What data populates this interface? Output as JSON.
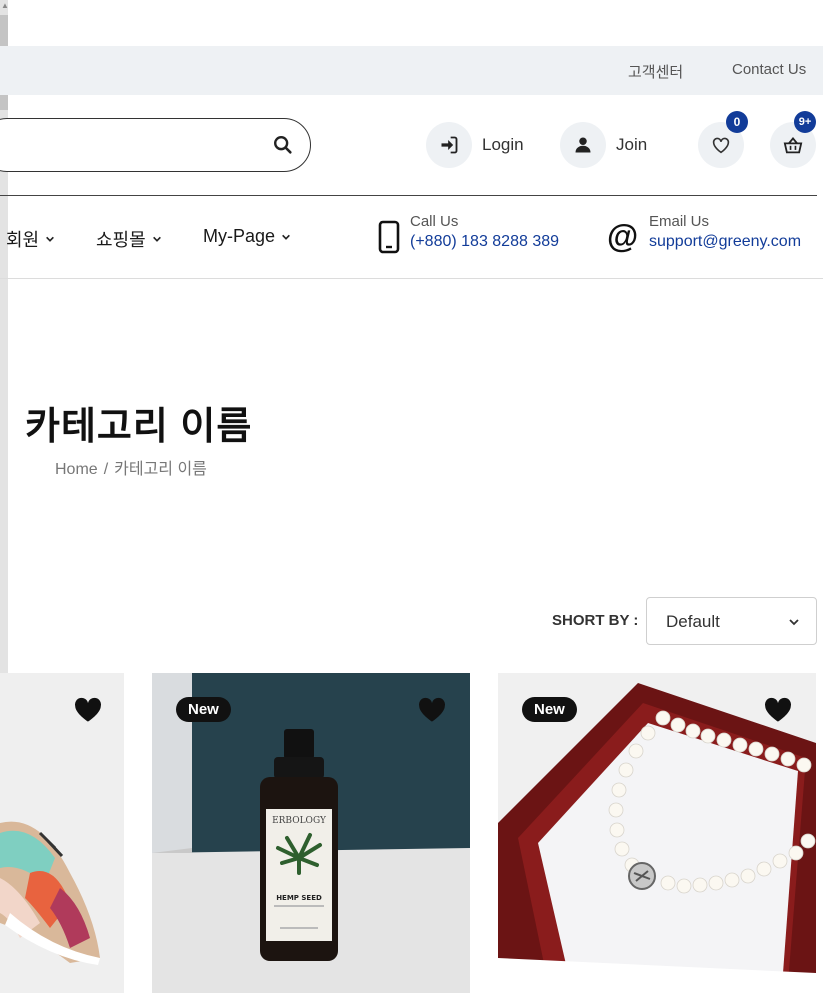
{
  "topbar": {
    "customer_center": "고객센터",
    "contact_us": "Contact Us"
  },
  "header": {
    "login_label": "Login",
    "join_label": "Join",
    "wishlist_count": "0",
    "cart_count": "9+"
  },
  "nav": {
    "items": [
      {
        "label": "회원"
      },
      {
        "label": "쇼핑몰"
      },
      {
        "label": "My-Page"
      }
    ],
    "call_title": "Call Us",
    "call_value": "(+880) 183 8288 389",
    "email_title": "Email Us",
    "email_value": "support@greeny.com"
  },
  "page": {
    "title": "카테고리 이름",
    "breadcrumb_home": "Home",
    "breadcrumb_sep": "/",
    "breadcrumb_current": "카테고리 이름"
  },
  "sort": {
    "label": "SHORT BY :",
    "value": "Default"
  },
  "products": [
    {
      "badge": "",
      "image": "sneaker"
    },
    {
      "badge": "New",
      "image": "hemp-seed-oil-bottle",
      "bottle_brand": "ERBOLOGY",
      "bottle_product": "HEMP SEED"
    },
    {
      "badge": "New",
      "image": "pearl-necklace"
    }
  ],
  "colors": {
    "accent": "#123c99",
    "topbar_bg": "#eef1f4",
    "badge_bg": "#111111"
  }
}
